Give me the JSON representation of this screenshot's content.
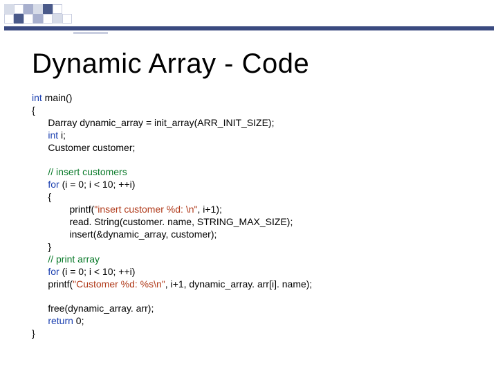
{
  "slide": {
    "title": "Dynamic Array - Code"
  },
  "code": {
    "l01_kw": "int",
    "l01_rest": " main()",
    "l02": "{",
    "l03": "      Darray dynamic_array = init_array(ARR_INIT_SIZE);",
    "l04_kw": "int",
    "l04_rest": " i;",
    "l05": "      Customer customer;",
    "blank1": " ",
    "l06_cm": "// insert customers",
    "l07_kw": "for",
    "l07_rest": " (i = 0; i < 10; ++i)",
    "l08": "      {",
    "l09a": "              printf(",
    "l09s": "\"insert customer %d: \\n\"",
    "l09b": ", i+1);",
    "l10": "              read. String(customer. name, STRING_MAX_SIZE);",
    "l11": "              insert(&dynamic_array, customer);",
    "l12": "      }",
    "l13_cm": "// print array",
    "l14_kw": "for",
    "l14_rest": " (i = 0; i < 10; ++i)",
    "l15a": "      printf(",
    "l15s": "\"Customer %d: %s\\n\"",
    "l15b": ", i+1, dynamic_array. arr[i]. name);",
    "blank2": " ",
    "l16": "      free(dynamic_array. arr);",
    "l17_kw": "return",
    "l17_rest": " 0;",
    "l18": "}"
  }
}
